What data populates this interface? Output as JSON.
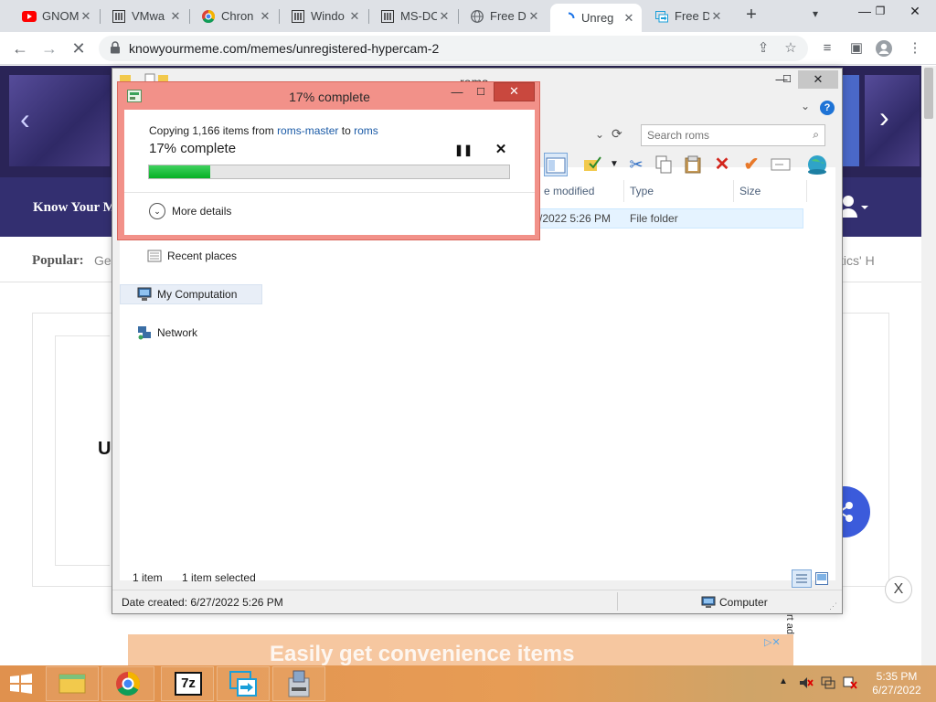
{
  "browser": {
    "tabs": [
      {
        "label": "GNOM",
        "icon": "youtube-icon",
        "active": false
      },
      {
        "label": "VMwa",
        "icon": "museum-icon",
        "active": false
      },
      {
        "label": "Chron",
        "icon": "chrome-icon",
        "active": false
      },
      {
        "label": "Windo",
        "icon": "museum-icon",
        "active": false
      },
      {
        "label": "MS-DC",
        "icon": "museum-icon",
        "active": false
      },
      {
        "label": "Free D",
        "icon": "globe-icon",
        "active": false
      },
      {
        "label": "Unreg",
        "icon": "loading-icon",
        "active": true
      },
      {
        "label": "Free D",
        "icon": "transfer-icon",
        "active": false
      }
    ],
    "new_tab_symbol": "+",
    "url": "knowyourmeme.com/memes/unregistered-hypercam-2",
    "colors": {
      "tabstrip": "#dee1e6",
      "active_tab": "#ffffff",
      "youtube_red": "#ff0000"
    }
  },
  "webpage": {
    "site_logo": "Know Your M",
    "popular_label": "Popular:",
    "popular_item_left": "Ge",
    "popular_item_right": "stics' H",
    "card_fragment": "U",
    "ad_text": "Easily get convenience items",
    "ad_close": "X",
    "ad_vertical": "rt ad",
    "colors": {
      "banner": "#2a2457",
      "navbar": "#332f70",
      "share_button": "#3b5bdb"
    }
  },
  "explorer": {
    "title": "roms",
    "search_placeholder": "Search roms",
    "columns": [
      "e modified",
      "Type",
      "Size"
    ],
    "row": {
      "date": "/2022 5:26 PM",
      "type": "File folder"
    },
    "nav": {
      "recent_places": "Recent places",
      "my_computation": "My Computation",
      "network": "Network"
    },
    "status_items": "1 item",
    "status_selected": "1 item selected",
    "date_created": "Date created: 6/27/2022 5:26 PM",
    "computer_label": "Computer"
  },
  "copy_dialog": {
    "title": "17% complete",
    "line_prefix": "Copying 1,166 items from ",
    "source": "roms-master",
    "line_mid": " to ",
    "destination": "roms",
    "percent_text": "17% complete",
    "progress_fraction": 0.17,
    "more_details": "More details",
    "colors": {
      "frame": "#f29189",
      "close": "#c9483e",
      "progress": "#06b025"
    }
  },
  "taskbar": {
    "time": "5:35 PM",
    "date": "6/27/2022",
    "apps": [
      "file-explorer-icon",
      "chrome-icon",
      "7zip-icon",
      "remote-desktop-icon",
      "installer-icon"
    ],
    "app_label_7z": "7z"
  }
}
